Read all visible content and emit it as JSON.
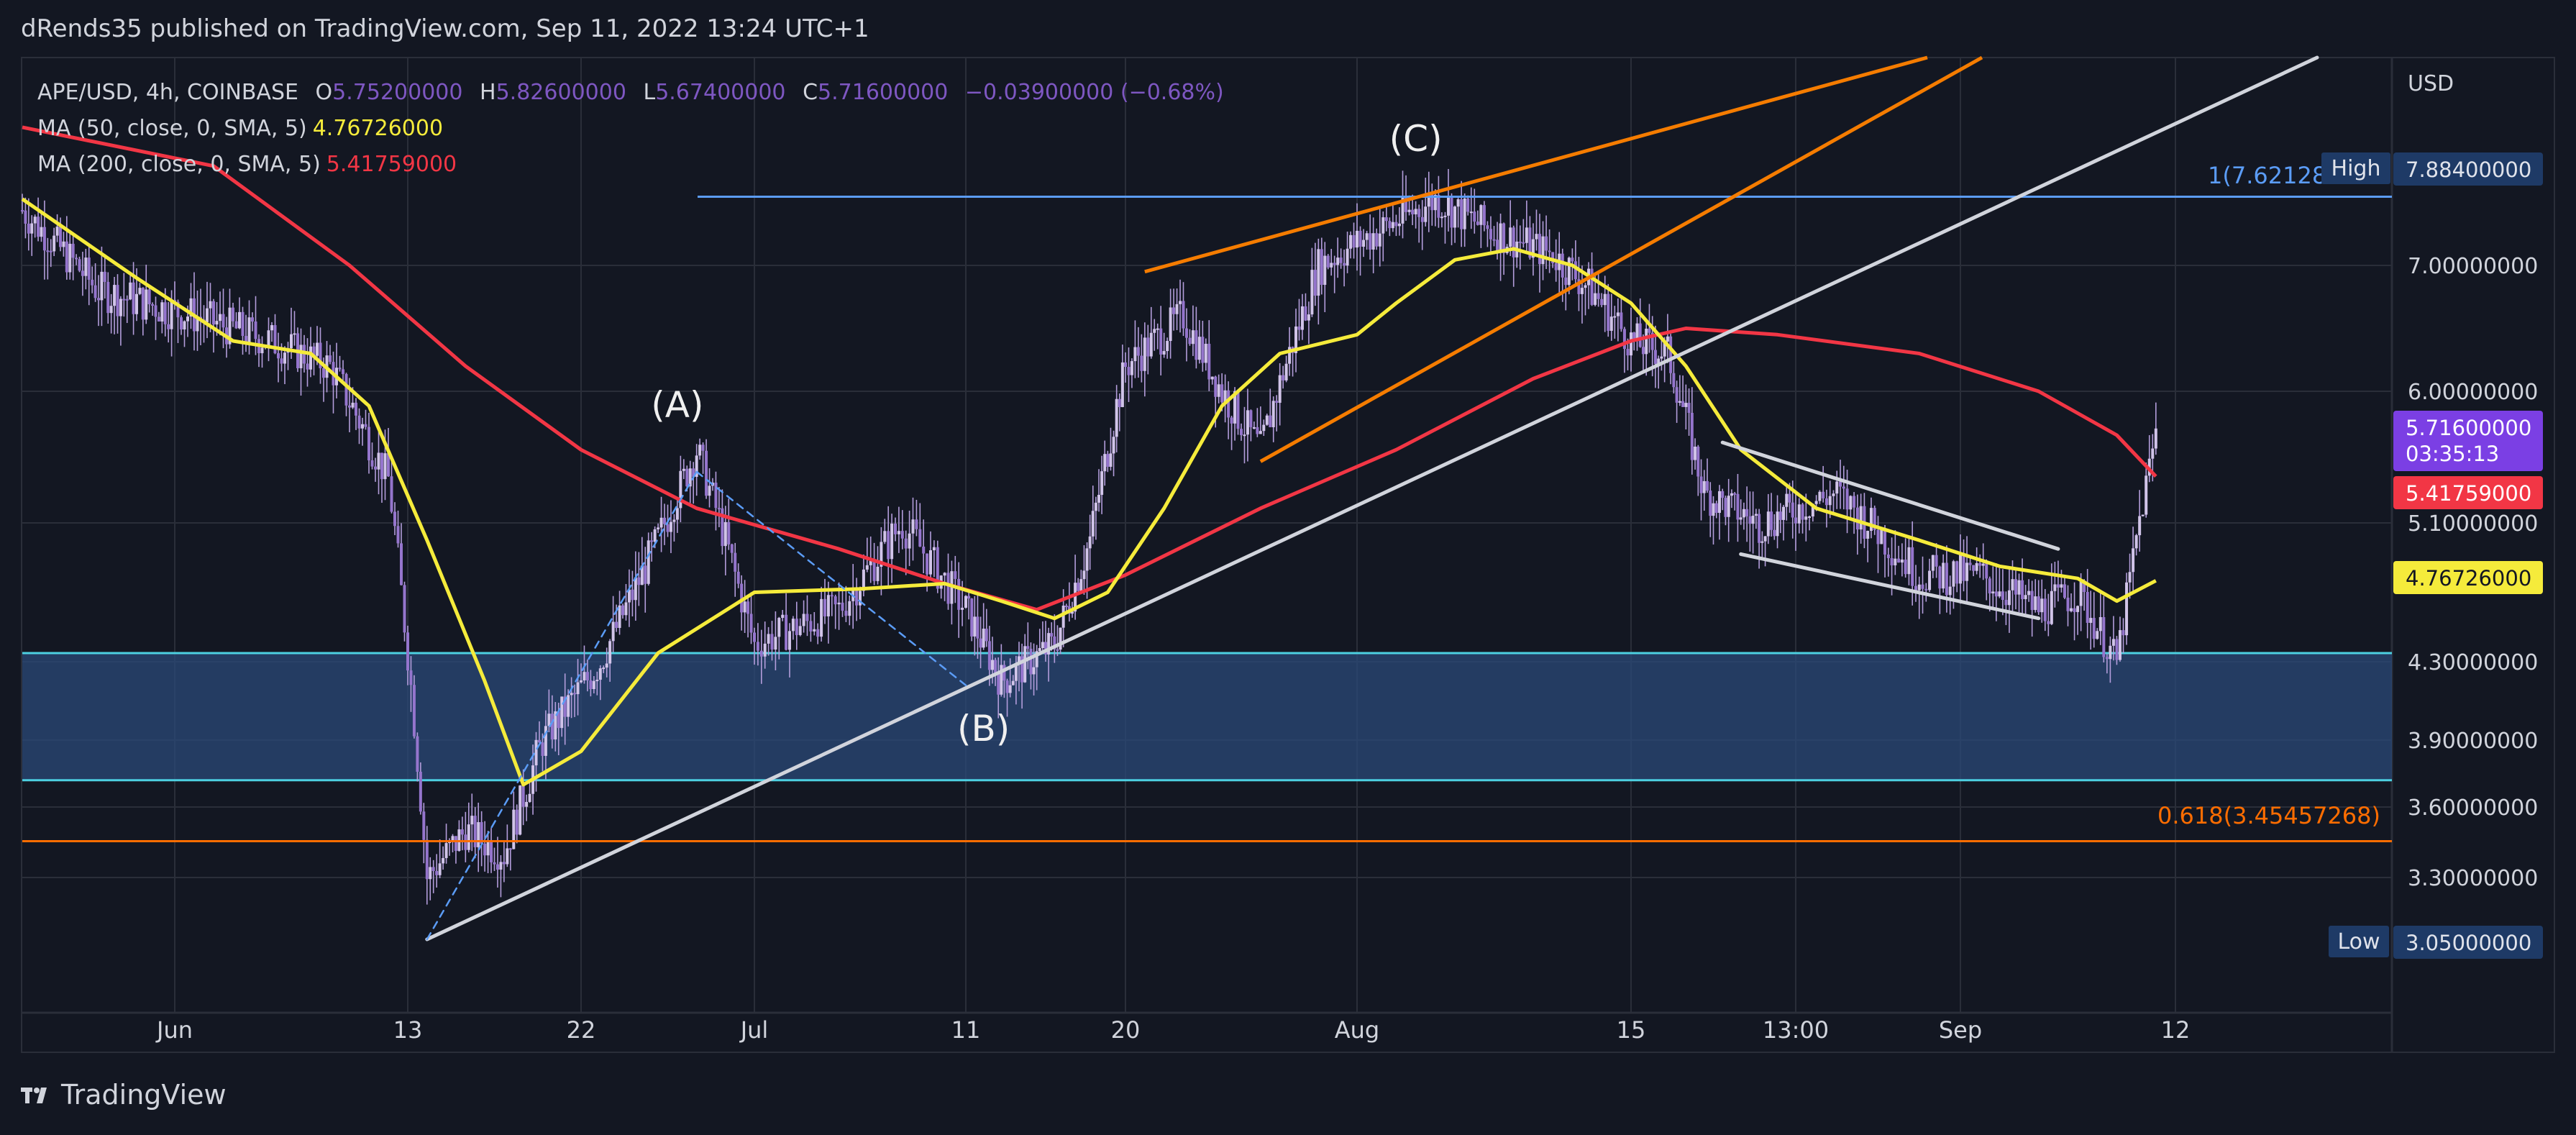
{
  "publisher_line": "dRends35 published on TradingView.com, Sep 11, 2022 13:24 UTC+1",
  "footer_brand": "TradingView",
  "legend": {
    "symbol": "APE/USD, 4h, COINBASE",
    "o_label": "O",
    "o_value": "5.75200000",
    "h_label": "H",
    "h_value": "5.82600000",
    "l_label": "L",
    "l_value": "5.67400000",
    "c_label": "C",
    "c_value": "5.71600000",
    "change": "−0.03900000 (−0.68%)",
    "ma50_label": "MA (50, close, 0, SMA, 5)",
    "ma50_value": "4.76726000",
    "ma200_label": "MA (200, close, 0, SMA, 5)",
    "ma200_value": "5.41759000"
  },
  "colors": {
    "background": "#131722",
    "grid": "#2a2e39",
    "candle": "#b39ddb",
    "ma50": "#f5eb3b",
    "ma200": "#f23645",
    "trend_white": "#d1d4dc",
    "channel": "#f57c00",
    "zone_fill": "#2b4a78",
    "zone_edge": "#4dd0e1",
    "fib_blue": "#5b9cf6",
    "fib_orange": "#ff6d00"
  },
  "chart_data": {
    "type": "candlestick",
    "instrument": "APE/USD",
    "timeframe": "4h",
    "exchange": "COINBASE",
    "y_axis_unit": "USD",
    "x_ticks": [
      "Jun",
      "13",
      "22",
      "Jul",
      "11",
      "20",
      "Aug",
      "15",
      "13:00",
      "Sep",
      "12"
    ],
    "x_tick_dates": [
      "2022-06-01",
      "2022-06-13",
      "2022-06-22",
      "2022-07-01",
      "2022-07-11",
      "2022-07-20",
      "2022-08-01",
      "2022-08-15",
      "2022-08-24",
      "2022-09-01",
      "2022-09-12"
    ],
    "y_ticks": [
      "7.00000000",
      "6.00000000",
      "5.10000000",
      "4.30000000",
      "3.90000000",
      "3.60000000",
      "3.30000000"
    ],
    "price_closes": {
      "dates": [
        "2022-05-24",
        "2022-05-28",
        "2022-06-02",
        "2022-06-06",
        "2022-06-09",
        "2022-06-12",
        "2022-06-14",
        "2022-06-16",
        "2022-06-18",
        "2022-06-20",
        "2022-06-23",
        "2022-06-26",
        "2022-06-28",
        "2022-07-01",
        "2022-07-05",
        "2022-07-08",
        "2022-07-11",
        "2022-07-13",
        "2022-07-16",
        "2022-07-18",
        "2022-07-20",
        "2022-07-23",
        "2022-07-25",
        "2022-07-27",
        "2022-07-30",
        "2022-08-02",
        "2022-08-05",
        "2022-08-08",
        "2022-08-11",
        "2022-08-13",
        "2022-08-15",
        "2022-08-17",
        "2022-08-19",
        "2022-08-22",
        "2022-08-26",
        "2022-08-30",
        "2022-09-02",
        "2022-09-05",
        "2022-09-07",
        "2022-09-09",
        "2022-09-10",
        "2022-09-11"
      ],
      "close": [
        7.5,
        6.8,
        6.6,
        6.4,
        6.2,
        5.4,
        3.3,
        3.5,
        3.4,
        3.9,
        4.3,
        5.0,
        5.6,
        4.4,
        4.6,
        5.1,
        4.6,
        4.2,
        4.4,
        5.0,
        6.2,
        6.6,
        6.0,
        5.6,
        7.0,
        7.3,
        7.6,
        7.3,
        7.1,
        6.8,
        6.4,
        6.3,
        5.3,
        5.1,
        5.3,
        4.8,
        4.8,
        4.6,
        4.7,
        4.3,
        5.0,
        5.716
      ]
    },
    "series": [
      {
        "name": "MA (50, close, 0, SMA, 5)",
        "dates": [
          "2022-05-24",
          "2022-05-30",
          "2022-06-04",
          "2022-06-08",
          "2022-06-11",
          "2022-06-14",
          "2022-06-17",
          "2022-06-19",
          "2022-06-22",
          "2022-06-26",
          "2022-07-01",
          "2022-07-06",
          "2022-07-10",
          "2022-07-13",
          "2022-07-16",
          "2022-07-19",
          "2022-07-22",
          "2022-07-25",
          "2022-07-28",
          "2022-08-01",
          "2022-08-03",
          "2022-08-06",
          "2022-08-09",
          "2022-08-12",
          "2022-08-15",
          "2022-08-18",
          "2022-08-21",
          "2022-08-25",
          "2022-08-30",
          "2022-09-03",
          "2022-09-07",
          "2022-09-09",
          "2022-09-11"
        ],
        "values": [
          7.6,
          6.9,
          6.4,
          6.3,
          5.9,
          5.0,
          4.2,
          3.7,
          3.85,
          4.35,
          4.7,
          4.72,
          4.75,
          4.65,
          4.55,
          4.7,
          5.2,
          5.9,
          6.3,
          6.45,
          6.7,
          7.05,
          7.15,
          7.0,
          6.7,
          6.2,
          5.6,
          5.2,
          5.0,
          4.85,
          4.78,
          4.65,
          4.767
        ]
      },
      {
        "name": "MA (200, close, 0, SMA, 5)",
        "dates": [
          "2022-05-24",
          "2022-06-03",
          "2022-06-10",
          "2022-06-16",
          "2022-06-22",
          "2022-06-28",
          "2022-07-05",
          "2022-07-10",
          "2022-07-15",
          "2022-07-20",
          "2022-07-27",
          "2022-08-03",
          "2022-08-10",
          "2022-08-15",
          "2022-08-18",
          "2022-08-23",
          "2022-08-30",
          "2022-09-05",
          "2022-09-09",
          "2022-09-11"
        ],
        "values": [
          8.3,
          7.9,
          7.0,
          6.2,
          5.6,
          5.2,
          4.95,
          4.75,
          4.6,
          4.8,
          5.2,
          5.6,
          6.1,
          6.4,
          6.5,
          6.45,
          6.3,
          6.0,
          5.7,
          5.418
        ]
      }
    ],
    "annotations": {
      "wave_labels": [
        {
          "text": "(A)",
          "date": "2022-06-27",
          "price": 5.45
        },
        {
          "text": "(B)",
          "date": "2022-07-12",
          "price": 4.17
        },
        {
          "text": "(C)",
          "date": "2022-08-04",
          "price": 7.75
        }
      ],
      "demand_zone": {
        "low": 3.72,
        "high": 4.35
      },
      "fib_levels": [
        {
          "label": "1(7.62128",
          "price": 7.621
        },
        {
          "label": "0.618(3.45457268)",
          "price": 3.4546
        }
      ],
      "price_labels": [
        {
          "name": "High",
          "value": "7.88400000"
        },
        {
          "name": "Low",
          "value": "3.05000000"
        },
        {
          "name": "last_price",
          "value": "5.71600000",
          "countdown": "03:35:13"
        },
        {
          "name": "ma200",
          "value": "5.41759000"
        },
        {
          "name": "ma50",
          "value": "4.76726000"
        }
      ]
    },
    "grid": true,
    "legend_position": "top-left"
  }
}
